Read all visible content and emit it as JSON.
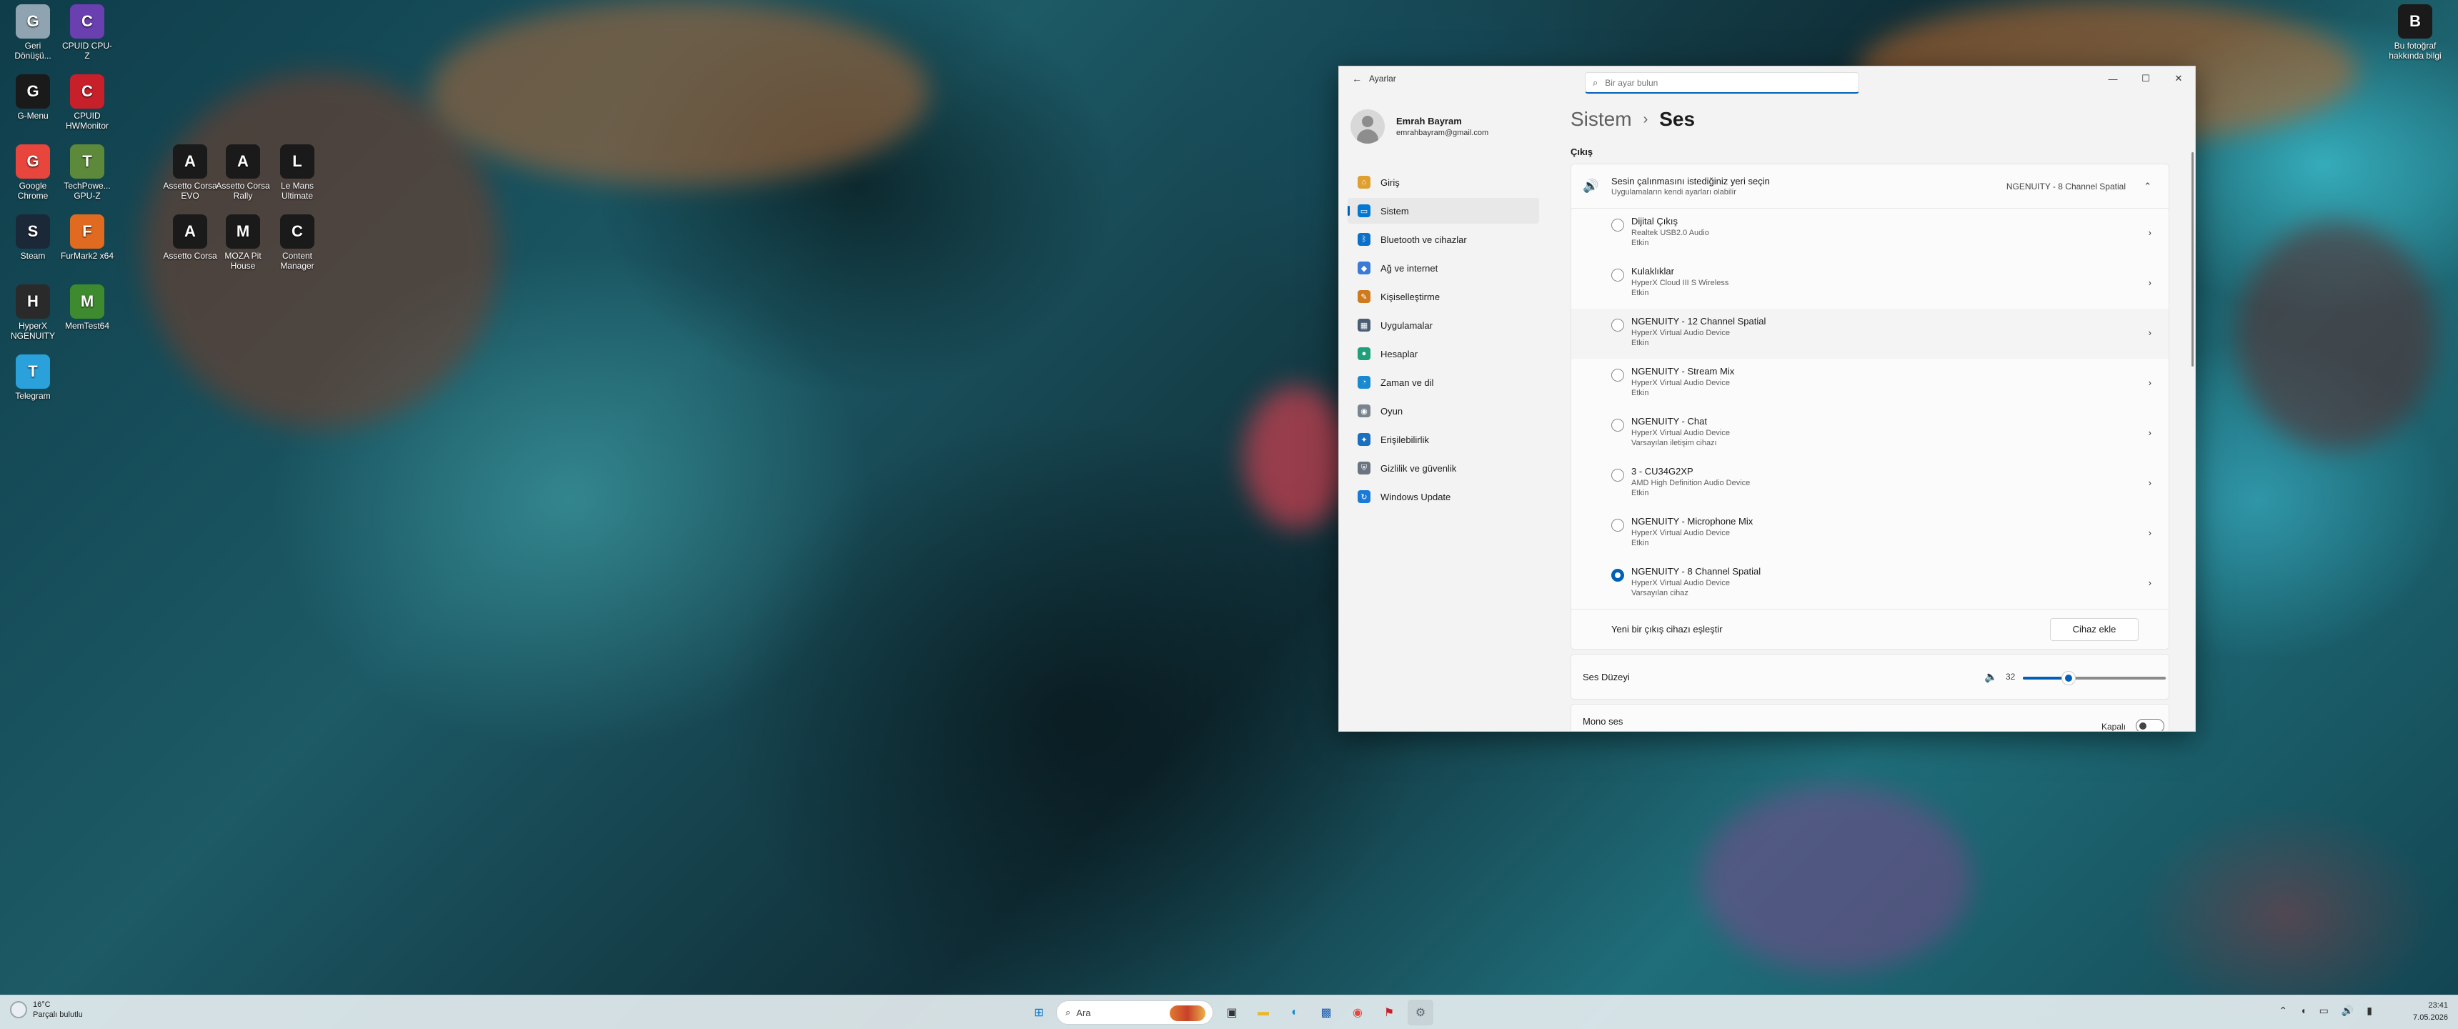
{
  "desktop": {
    "icons": [
      {
        "label": "Geri Dönüşü...",
        "icon": "recycle-bin-icon",
        "color": "#8fa4b0"
      },
      {
        "label": "CPUID CPU-Z",
        "icon": "cpuz-icon",
        "color": "#6a3fb0"
      },
      {
        "label": "G-Menu",
        "icon": "gmenu-icon",
        "color": "#1a1a1a"
      },
      {
        "label": "CPUID HWMonitor",
        "icon": "hwmonitor-icon",
        "color": "#c8202a"
      },
      {
        "label": "Google Chrome",
        "icon": "chrome-icon",
        "color": "#e8453c"
      },
      {
        "label": "TechPowe... GPU-Z",
        "icon": "gpuz-icon",
        "color": "#5d8a3a"
      },
      {
        "label": "Steam",
        "icon": "steam-icon",
        "color": "#1b2838"
      },
      {
        "label": "FurMark2 x64",
        "icon": "furmark-icon",
        "color": "#e06a20"
      },
      {
        "label": "HyperX NGENUITY",
        "icon": "ngenuity-icon",
        "color": "#2a2a2a"
      },
      {
        "label": "MemTest64",
        "icon": "memtest-icon",
        "color": "#3e8a2e"
      },
      {
        "label": "Telegram",
        "icon": "telegram-icon",
        "color": "#2aa1da"
      },
      {
        "label": "Assetto Corsa EVO",
        "icon": "ac-evo-icon",
        "color": "#1a1a1a"
      },
      {
        "label": "Assetto Corsa Rally",
        "icon": "ac-rally-icon",
        "color": "#1a1a1a"
      },
      {
        "label": "Le Mans Ultimate",
        "icon": "lmu-icon",
        "color": "#1a1a1a"
      },
      {
        "label": "Assetto Corsa",
        "icon": "assetto-corsa-icon",
        "color": "#1a1a1a"
      },
      {
        "label": "MOZA Pit House",
        "icon": "moza-icon",
        "color": "#1a1a1a"
      },
      {
        "label": "Content Manager",
        "icon": "content-manager-icon",
        "color": "#1a1a1a"
      },
      {
        "label": "Bu fotoğraf hakkında bilgi",
        "icon": "camera-icon",
        "color": "#1a1a1a"
      }
    ]
  },
  "window": {
    "title": "Ayarlar",
    "back_glyph": "←",
    "search_placeholder": "Bir ayar bulun",
    "min_glyph": "—",
    "max_glyph": "☐",
    "close_glyph": "✕",
    "user": {
      "name": "Emrah Bayram",
      "email": "emrahbayram@gmail.com"
    },
    "nav": [
      {
        "label": "Giriş",
        "icon": "home-icon",
        "color": "#e0a030",
        "glyph": "⌂"
      },
      {
        "label": "Sistem",
        "icon": "system-icon",
        "color": "#0078d4",
        "glyph": "▭"
      },
      {
        "label": "Bluetooth ve cihazlar",
        "icon": "bluetooth-icon",
        "color": "#0a70c8",
        "glyph": "ᛒ"
      },
      {
        "label": "Ağ ve internet",
        "icon": "network-icon",
        "color": "#3a7bd5",
        "glyph": "◆"
      },
      {
        "label": "Kişiselleştirme",
        "icon": "personalization-icon",
        "color": "#d07a20",
        "glyph": "✎"
      },
      {
        "label": "Uygulamalar",
        "icon": "apps-icon",
        "color": "#4a5d73",
        "glyph": "▦"
      },
      {
        "label": "Hesaplar",
        "icon": "accounts-icon",
        "color": "#1fa07a",
        "glyph": "●"
      },
      {
        "label": "Zaman ve dil",
        "icon": "time-language-icon",
        "color": "#1a8ad0",
        "glyph": "◔"
      },
      {
        "label": "Oyun",
        "icon": "gaming-icon",
        "color": "#7a8490",
        "glyph": "◉"
      },
      {
        "label": "Erişilebilirlik",
        "icon": "accessibility-icon",
        "color": "#1a6fc0",
        "glyph": "✦"
      },
      {
        "label": "Gizlilik ve güvenlik",
        "icon": "privacy-icon",
        "color": "#6a7480",
        "glyph": "⛨"
      },
      {
        "label": "Windows Update",
        "icon": "windows-update-icon",
        "color": "#1a7ad8",
        "glyph": "↻"
      }
    ],
    "active_nav": "Sistem"
  },
  "content": {
    "breadcrumb_parent": "Sistem",
    "breadcrumb_sep": "›",
    "breadcrumb_current": "Ses",
    "output_label": "Çıkış",
    "output_panel": {
      "title": "Sesin çalınmasını istediğiniz yeri seçin",
      "subtitle": "Uygulamaların kendi ayarları olabilir",
      "selected": "NGENUITY - 8 Channel Spatial",
      "collapse_glyph": "⌃"
    },
    "devices": [
      {
        "name": "Dijital Çıkış",
        "sub": "Realtek USB2.0 Audio",
        "status": "Etkin",
        "selected": false
      },
      {
        "name": "Kulaklıklar",
        "sub": "HyperX Cloud III S Wireless",
        "status": "Etkin",
        "selected": false
      },
      {
        "name": "NGENUITY - 12 Channel Spatial",
        "sub": "HyperX Virtual Audio Device",
        "status": "Etkin",
        "selected": false
      },
      {
        "name": "NGENUITY - Stream Mix",
        "sub": "HyperX Virtual Audio Device",
        "status": "Etkin",
        "selected": false
      },
      {
        "name": "NGENUITY - Chat",
        "sub": "HyperX Virtual Audio Device",
        "status": "Varsayılan iletişim cihazı",
        "selected": false
      },
      {
        "name": "3 - CU34G2XP",
        "sub": "AMD High Definition Audio Device",
        "status": "Etkin",
        "selected": false
      },
      {
        "name": "NGENUITY - Microphone Mix",
        "sub": "HyperX Virtual Audio Device",
        "status": "Etkin",
        "selected": false
      },
      {
        "name": "NGENUITY - 8 Channel Spatial",
        "sub": "HyperX Virtual Audio Device",
        "status": "Varsayılan cihaz",
        "selected": true
      }
    ],
    "pair_label": "Yeni bir çıkış cihazı eşleştir",
    "pair_button": "Cihaz ekle",
    "volume_label": "Ses Düzeyi",
    "volume_value": "32",
    "volume_level": 0.32,
    "mono_label": "Mono ses",
    "mono_state": "Kapalı",
    "accent": "#005fb8"
  },
  "taskbar": {
    "weather_temp": "16°C",
    "weather_desc": "Parçalı bulutlu",
    "search_label": "Ara",
    "apps": [
      {
        "name": "start-button",
        "glyph": "⊞",
        "color": "#0078d4"
      },
      {
        "name": "taskview-button",
        "glyph": "▣",
        "color": "#333333"
      },
      {
        "name": "file-explorer-button",
        "glyph": "▬",
        "color": "#e8b830"
      },
      {
        "name": "edge-button",
        "glyph": "◐",
        "color": "#1a8ad0"
      },
      {
        "name": "store-button",
        "glyph": "▩",
        "color": "#1a5ab0"
      },
      {
        "name": "chrome-button",
        "glyph": "◉",
        "color": "#e8453c"
      },
      {
        "name": "ac-button",
        "glyph": "⚑",
        "color": "#c8202a"
      },
      {
        "name": "settings-button",
        "glyph": "⚙",
        "color": "#5a6470"
      }
    ],
    "tray": [
      "⌃",
      "◖",
      "▭",
      "🔊",
      "▮"
    ],
    "time": "23:41",
    "date": "7.05.2026"
  }
}
